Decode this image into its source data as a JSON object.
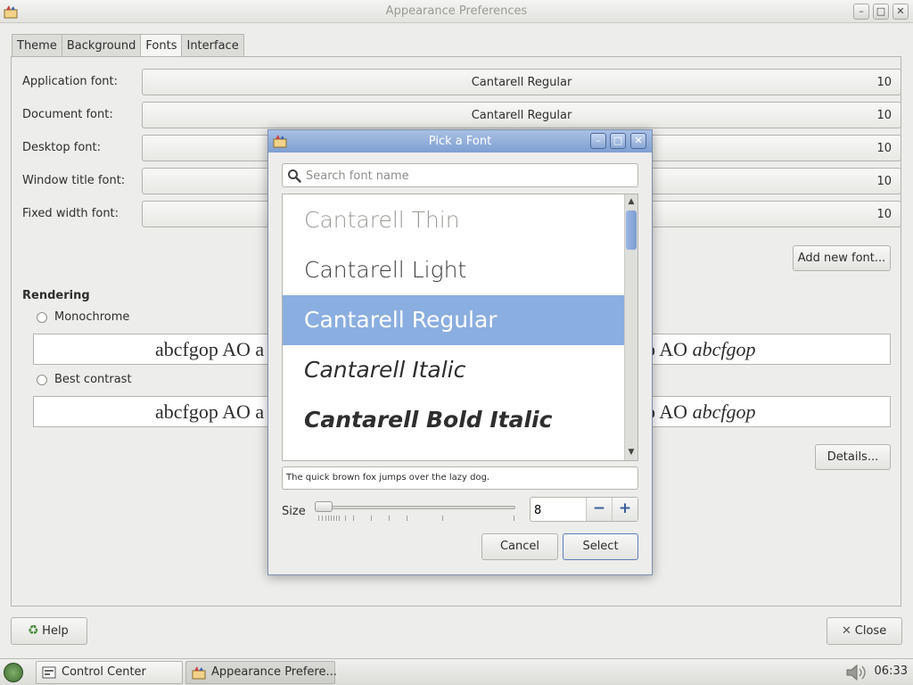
{
  "window": {
    "title": "Appearance Preferences",
    "controls": {
      "minimize": "–",
      "maximize": "□",
      "close": "✕"
    }
  },
  "tabs": [
    {
      "label": "Theme"
    },
    {
      "label": "Background"
    },
    {
      "label": "Fonts",
      "active": true
    },
    {
      "label": "Interface"
    }
  ],
  "fonts": {
    "rows": [
      {
        "label": "Application font:",
        "font": "Cantarell Regular",
        "size": "10"
      },
      {
        "label": "Document font:",
        "font": "Cantarell Regular",
        "size": "10"
      },
      {
        "label": "Desktop font:",
        "font": "",
        "size": "10"
      },
      {
        "label": "Window title font:",
        "font": "",
        "size": "10"
      },
      {
        "label": "Fixed width font:",
        "font": "",
        "size": "10"
      }
    ],
    "add_button": "Add new font..."
  },
  "rendering": {
    "title": "Rendering",
    "options": [
      {
        "label": "Monochrome",
        "sample_left": "abcfgop AO a",
        "sample_right": "o AO abcfgop"
      },
      {
        "label": "Best contrast",
        "sample_left": "abcfgop AO a",
        "sample_right": "o AO abcfgop"
      }
    ],
    "details_button": "Details..."
  },
  "footer": {
    "help": "Help",
    "close": "Close"
  },
  "dialog": {
    "title": "Pick a Font",
    "search_placeholder": "Search font name",
    "font_list": [
      {
        "name": "Cantarell Thin",
        "style": "thin"
      },
      {
        "name": "Cantarell Light",
        "style": "light"
      },
      {
        "name": "Cantarell Regular",
        "style": "regular",
        "selected": true
      },
      {
        "name": "Cantarell Italic",
        "style": "italic"
      },
      {
        "name": "Cantarell Bold Italic",
        "style": "bold-italic"
      }
    ],
    "preview_text": "The quick brown fox jumps over the lazy dog.",
    "size_label": "Size",
    "size_value": "8",
    "size_minus": "−",
    "size_plus": "+",
    "cancel": "Cancel",
    "select": "Select"
  },
  "taskbar": {
    "tasks": [
      {
        "label": "Control Center"
      },
      {
        "label": "Appearance Prefere...",
        "active": true
      }
    ],
    "clock": "06:33"
  },
  "colors": {
    "accent": "#8aaedf",
    "dialog_title": "#7f9fd1",
    "spin_icon": "#3a5f9b"
  }
}
